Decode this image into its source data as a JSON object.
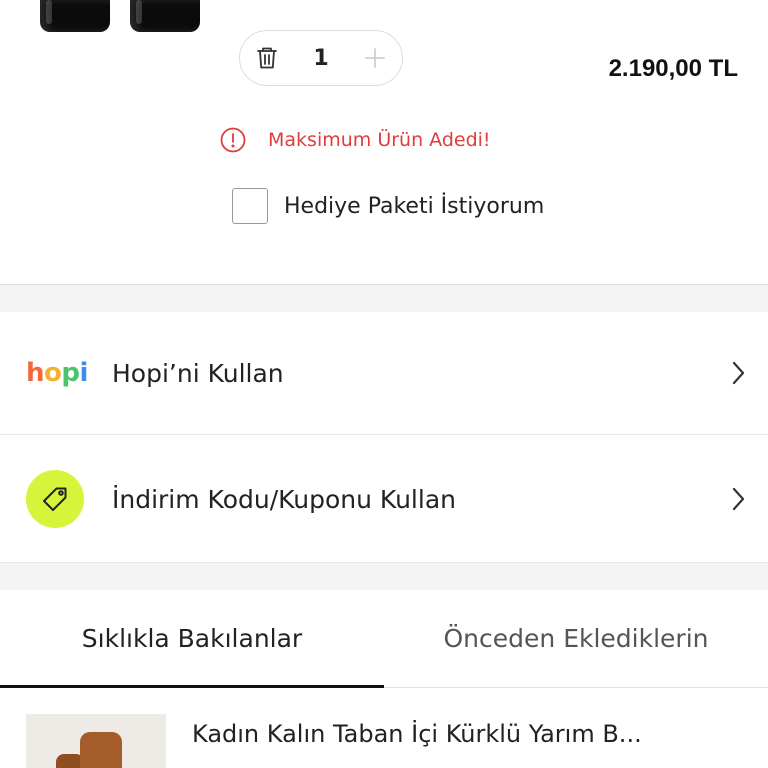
{
  "cart_item": {
    "quantity": "1",
    "price": "2.190,00 TL",
    "max_warning": "Maksimum Ürün Adedi!",
    "gift_label": "Hediye Paketi İstiyorum",
    "gift_checked": false
  },
  "options": {
    "hopi": {
      "logo_text": "hopi",
      "label": "Hopi’ni Kullan"
    },
    "coupon": {
      "label": "İndirim Kodu/Kuponu Kullan"
    }
  },
  "tabs": [
    {
      "label": "Sıklıkla Bakılanlar",
      "active": true
    },
    {
      "label": "Önceden Eklediklerin",
      "active": false
    }
  ],
  "recommended": [
    {
      "title": "Kadın Kalın Taban İçi Kürklü Yarım B..."
    }
  ],
  "colors": {
    "warning": "#e03c3c",
    "coupon_icon_bg": "#d6f53a",
    "active_tab_underline": "#111111"
  },
  "icons": [
    "trash-icon",
    "plus-icon",
    "warning-icon",
    "chevron-right-icon",
    "tag-icon"
  ]
}
